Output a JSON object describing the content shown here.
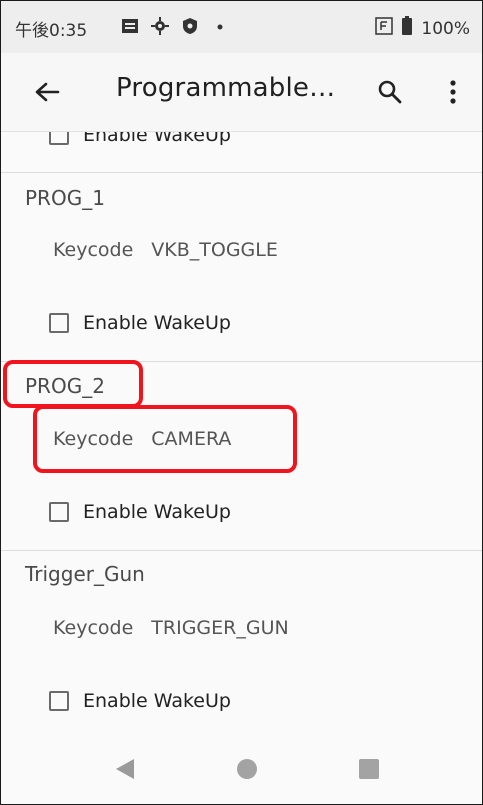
{
  "status_bar": {
    "time": "午後0:35",
    "left_icons": [
      "gallery-icon",
      "settings-icon",
      "shield-icon",
      "dot-icon"
    ],
    "right_icons": [
      "f-box-icon",
      "battery-icon"
    ],
    "battery": "100%"
  },
  "app_bar": {
    "title": "Programmable…",
    "icons": [
      "arrow-left-icon",
      "search-icon",
      "more-vertical-icon"
    ]
  },
  "sections": [
    {
      "checkbox_label": "Enable WakeUp",
      "checked": false
    },
    {
      "title": "PROG_1",
      "keycode_label": "Keycode",
      "keycode_value": "VKB_TOGGLE",
      "checkbox_label": "Enable WakeUp",
      "checked": false
    },
    {
      "title": "PROG_2",
      "keycode_label": "Keycode",
      "keycode_value": "CAMERA",
      "checkbox_label": "Enable WakeUp",
      "checked": false
    },
    {
      "title": "Trigger_Gun",
      "keycode_label": "Keycode",
      "keycode_value": "TRIGGER_GUN",
      "checkbox_label": "Enable WakeUp",
      "checked": false
    }
  ],
  "annotations": {
    "highlight_color": "#f0141e"
  },
  "nav_bar": {
    "icons": [
      "back-triangle-icon",
      "home-circle-icon",
      "recents-square-icon"
    ]
  }
}
